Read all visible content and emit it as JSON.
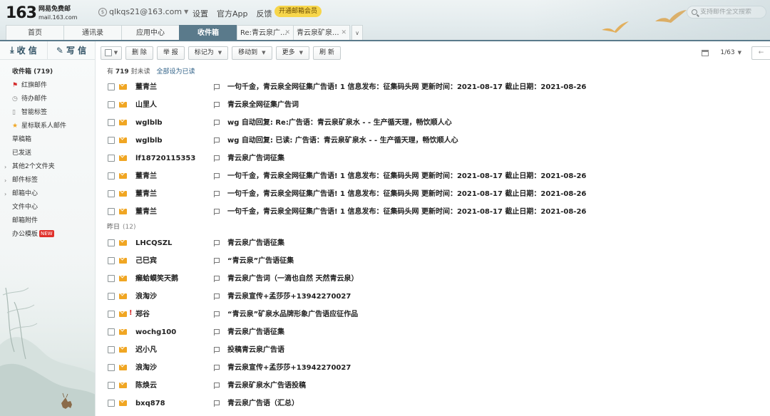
{
  "header": {
    "logo_number": "163",
    "logo_cn": "网易免费邮",
    "logo_domain": "mail.163.com",
    "account": "qlkqs21@163.com",
    "links": [
      "设置",
      "官方App",
      "反馈"
    ],
    "vip_label": "开通邮箱会员",
    "search_placeholder": "支持邮件全文搜索"
  },
  "tabs": [
    {
      "label": "首页"
    },
    {
      "label": "通讯录"
    },
    {
      "label": "应用中心"
    },
    {
      "label": "收件箱"
    },
    {
      "label": "Re:青云泉广..."
    },
    {
      "label": "青云泉矿泉..."
    }
  ],
  "sidebar": {
    "receive_label": "收 信",
    "compose_label": "写 信",
    "items": [
      {
        "label": "收件箱 (719)"
      },
      {
        "label": "红旗邮件"
      },
      {
        "label": "待办邮件"
      },
      {
        "label": "智能标签"
      },
      {
        "label": "星标联系人邮件"
      },
      {
        "label": "草稿箱"
      },
      {
        "label": "已发送"
      },
      {
        "label": "其他2个文件夹"
      },
      {
        "label": "邮件标签"
      },
      {
        "label": "邮箱中心"
      },
      {
        "label": "文件中心"
      },
      {
        "label": "邮箱附件"
      },
      {
        "label": "办公模板",
        "badge": "NEW"
      }
    ]
  },
  "toolbar": {
    "delete": "删 除",
    "report": "举 报",
    "mark_as": "标记为",
    "move_to": "移动到",
    "more": "更多",
    "refresh": "刷 新",
    "page": "1/63"
  },
  "summary": {
    "prefix": "有",
    "unread_count": "719",
    "suffix": "封未读",
    "mark_all_read": "全部设为已读"
  },
  "mail_today": [
    {
      "sender": "董青兰",
      "subject": "一句千金，青云泉全网征集广告语! 1 信息发布：征集码头网 更新时间：2021-08-17 截止日期：2021-08-26"
    },
    {
      "sender": "山里人",
      "subject": "青云泉全网征集广告词"
    },
    {
      "sender": "wglblb",
      "subject": "wg 自动回复: Re:广告语：青云泉矿泉水 - - 生产循天理，畅饮顺人心"
    },
    {
      "sender": "wglblb",
      "subject": "wg 自动回复: 已读: 广告语：青云泉矿泉水 - - 生产循天理，畅饮顺人心"
    },
    {
      "sender": "lf18720115353",
      "subject": "青云泉广告词征集"
    },
    {
      "sender": "董青兰",
      "subject": "一句千金，青云泉全网征集广告语! 1 信息发布：征集码头网 更新时间：2021-08-17 截止日期：2021-08-26"
    },
    {
      "sender": "董青兰",
      "subject": "一句千金，青云泉全网征集广告语! 1 信息发布：征集码头网 更新时间：2021-08-17 截止日期：2021-08-26"
    },
    {
      "sender": "董青兰",
      "subject": "一句千金，青云泉全网征集广告语! 1 信息发布：征集码头网 更新时间：2021-08-17 截止日期：2021-08-26"
    }
  ],
  "group_yesterday": {
    "label": "昨日",
    "count": "(12)"
  },
  "mail_yesterday": [
    {
      "sender": "LHCQSZL",
      "subject": "青云泉广告语征集"
    },
    {
      "sender": "己巳宾",
      "subject": "“青云泉”广告语征集"
    },
    {
      "sender": "癞蛤蟆笑天鹅",
      "subject": "青云泉广告词（一滴也自然 天然青云泉）"
    },
    {
      "sender": "浪淘沙",
      "subject": "青云泉宣传+孟莎莎+13942270027"
    },
    {
      "sender": "郑谷",
      "subject": "“青云泉”矿泉水品牌形象广告语应征作品",
      "important": true
    },
    {
      "sender": "wochg100",
      "subject": "青云泉广告语征集"
    },
    {
      "sender": "迟小凡",
      "subject": "投稿青云泉广告语"
    },
    {
      "sender": "浪淘沙",
      "subject": "青云泉宣传+孟莎莎+13942270027"
    },
    {
      "sender": "陈焕云",
      "subject": "青云泉矿泉水广告语投稿"
    },
    {
      "sender": "bxq878",
      "subject": "青云泉广告语（汇总）"
    }
  ],
  "icons": {
    "mail": "envelope-icon",
    "flag": "flag-icon",
    "red_flag": "red-flag-icon",
    "todo": "clock-icon",
    "tag": "tag-icon",
    "star": "star-icon"
  },
  "colors": {
    "accent": "#5a7a8b",
    "envelope": "#f0a623",
    "vip": "#f7d64b",
    "new_badge": "#e0302a"
  }
}
